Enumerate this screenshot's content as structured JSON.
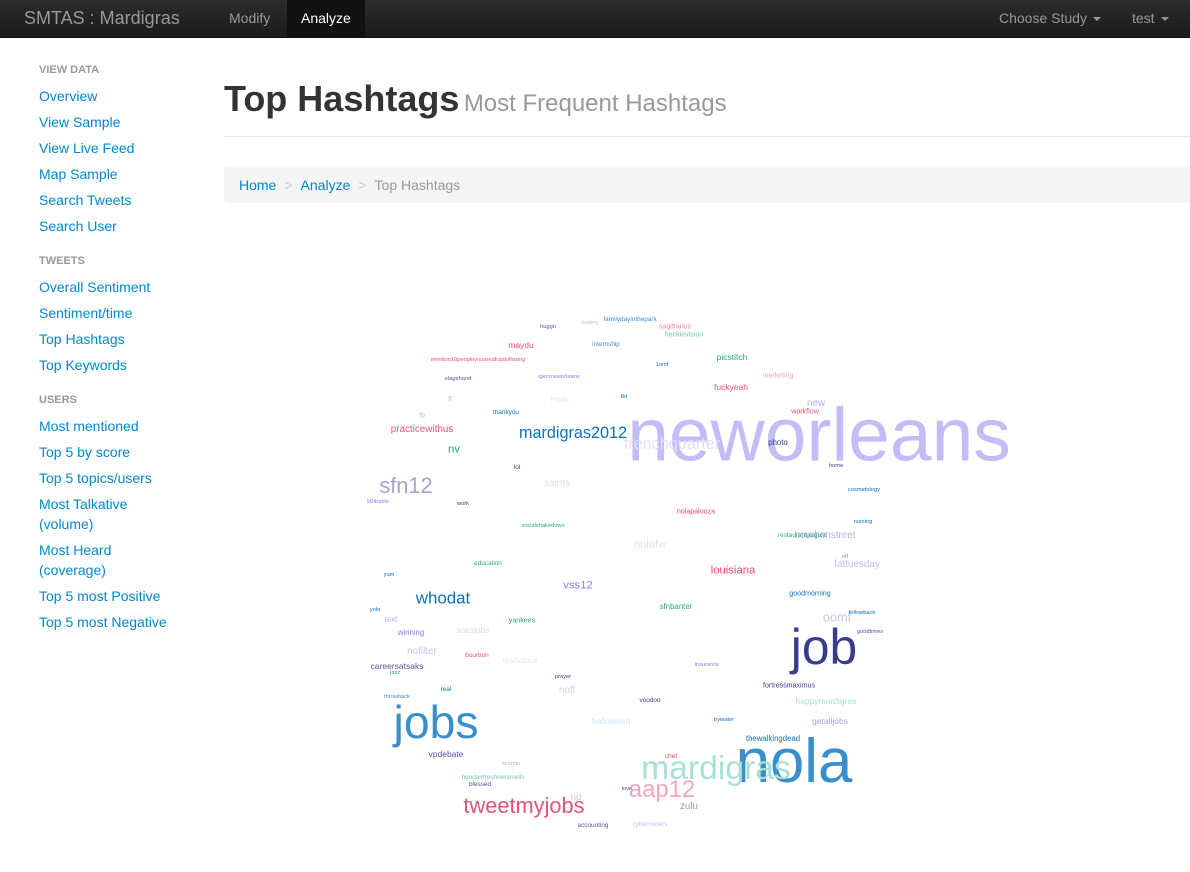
{
  "navbar": {
    "brand": "SMTAS : Mardigras",
    "items": [
      {
        "label": "Modify"
      },
      {
        "label": "Analyze",
        "active": true
      }
    ],
    "choose_study": "Choose Study",
    "user": "test"
  },
  "sidebar": {
    "sections": [
      {
        "header": "VIEW DATA",
        "items": [
          "Overview",
          "View Sample",
          "View Live Feed",
          "Map Sample",
          "Search Tweets",
          "Search User"
        ]
      },
      {
        "header": "TWEETS",
        "items": [
          "Overall Sentiment",
          "Sentiment/time",
          "Top Hashtags",
          "Top Keywords"
        ]
      },
      {
        "header": "USERS",
        "items": [
          "Most mentioned",
          "Top 5 by score",
          "Top 5 topics/users",
          "Most Talkative",
          "(volume)",
          "Most Heard",
          "(coverage)",
          "Top 5 most Positive",
          "Top 5 most Negative"
        ]
      }
    ]
  },
  "page": {
    "title": "Top Hashtags",
    "subtitle": "Most Frequent Hashtags"
  },
  "breadcrumb": {
    "home": "Home",
    "analyze": "Analyze",
    "current": "Top Hashtags",
    "separator": ">"
  },
  "wordcloud": {
    "words": [
      {
        "text": "neworleans",
        "weight": 100,
        "color": "#c2bcf7"
      },
      {
        "text": "nola",
        "weight": 81,
        "color": "#3a8ecb"
      },
      {
        "text": "job",
        "weight": 64,
        "color": "#393b8f"
      },
      {
        "text": "jobs",
        "weight": 59,
        "color": "#3a8ecb"
      },
      {
        "text": "mardigras",
        "weight": 41,
        "color": "#a8e0d5"
      },
      {
        "text": "aap12",
        "weight": 27,
        "color": "#f2a7bb"
      },
      {
        "text": "tweetmyjobs",
        "weight": 24,
        "color": "#e5527a"
      },
      {
        "text": "sfn12",
        "weight": 24,
        "color": "#a4a2cf"
      },
      {
        "text": "frenchquarter",
        "weight": 16,
        "color": "#e2def8"
      },
      {
        "text": "mardigras2012",
        "weight": 16,
        "color": "#1170b6"
      },
      {
        "text": "whodat",
        "weight": 17,
        "color": "#1170b6"
      },
      {
        "text": "louisiana",
        "weight": 9,
        "color": "#e84a6f"
      },
      {
        "text": "nolafw",
        "weight": 9,
        "color": "#fadbe3"
      },
      {
        "text": "practicewithus",
        "weight": 7,
        "color": "#e5527a"
      },
      {
        "text": "nv",
        "weight": 9,
        "color": "#2aa58a"
      },
      {
        "text": "vss12",
        "weight": 9,
        "color": "#8c7cf0"
      },
      {
        "text": "fattuesday",
        "weight": 7,
        "color": "#c2bcf7"
      },
      {
        "text": "bourbonstreet",
        "weight": 7,
        "color": "#b4b0dd"
      },
      {
        "text": "oomf",
        "weight": 11,
        "color": "#c9c4f5"
      },
      {
        "text": "new",
        "weight": 7,
        "color": "#b4b0f0"
      },
      {
        "text": "saints",
        "weight": 7,
        "color": "#dcdcf0"
      },
      {
        "text": "noff",
        "weight": 7,
        "color": "#d7d3f0"
      },
      {
        "text": "np",
        "weight": 7,
        "color": "#c9c4f5"
      },
      {
        "text": "nofilter",
        "weight": 7,
        "color": "#c9c4f5"
      },
      {
        "text": "zulu",
        "weight": 7,
        "color": "#9a98c9"
      },
      {
        "text": "happymardigras",
        "weight": 5,
        "color": "#a8e0d5"
      },
      {
        "text": "getalljobs",
        "weight": 5,
        "color": "#a79cf5"
      },
      {
        "text": "halloween",
        "weight": 5,
        "color": "#cfe0f2"
      },
      {
        "text": "vpdebate",
        "weight": 5,
        "color": "#5254a3"
      },
      {
        "text": "careersatsaks",
        "weight": 5,
        "color": "#5a56a0"
      },
      {
        "text": "saksjobs",
        "weight": 5,
        "color": "#cfe0f2"
      },
      {
        "text": "picstitch",
        "weight": 5,
        "color": "#2aa58a"
      },
      {
        "text": "fuckyeah",
        "weight": 5,
        "color": "#e5527a"
      },
      {
        "text": "thewalkingdead",
        "weight": 4,
        "color": "#1170b6"
      },
      {
        "text": "photo",
        "weight": 4,
        "color": "#393b8f"
      },
      {
        "text": "maydu",
        "weight": 5,
        "color": "#e5527a"
      },
      {
        "text": "sfnbanter",
        "weight": 4,
        "color": "#2aa58a"
      },
      {
        "text": "winning",
        "weight": 4,
        "color": "#8c7cf0"
      },
      {
        "text": "text",
        "weight": 4,
        "color": "#b4b0f0"
      },
      {
        "text": "yankees",
        "weight": 3,
        "color": "#2aa58a"
      },
      {
        "text": "reallydaux",
        "weight": 4,
        "color": "#dbe7f4"
      },
      {
        "text": "fortressmaximus",
        "weight": 3,
        "color": "#393b8f"
      },
      {
        "text": "marketing",
        "weight": 3,
        "color": "#f2a7bb"
      },
      {
        "text": "workflow",
        "weight": 3,
        "color": "#e5527a"
      },
      {
        "text": "music",
        "weight": 3,
        "color": "#dcdcf0"
      },
      {
        "text": "nolapalooza",
        "weight": 3,
        "color": "#e84a6f"
      },
      {
        "text": "goodmorning",
        "weight": 3,
        "color": "#1170b6"
      },
      {
        "text": "restaurantaugust",
        "weight": 2,
        "color": "#2aa58a"
      },
      {
        "text": "education",
        "weight": 2,
        "color": "#2aa58a"
      },
      {
        "text": "sagittarius",
        "weight": 3,
        "color": "#f08aa5"
      },
      {
        "text": "heckievision",
        "weight": 3,
        "color": "#6fc8b6"
      },
      {
        "text": "blessed",
        "weight": 2,
        "color": "#5254a3"
      },
      {
        "text": "hoodairfreshnersmells",
        "weight": 2,
        "color": "#6fc8b6"
      },
      {
        "text": "bourbon",
        "weight": 2,
        "color": "#e5527a"
      },
      {
        "text": "fb",
        "weight": 3,
        "color": "#c2bcf7"
      },
      {
        "text": "ff",
        "weight": 3,
        "color": "#c2bcf7"
      },
      {
        "text": "accounting",
        "weight": 2,
        "color": "#5254a3"
      },
      {
        "text": "cybercoders",
        "weight": 2,
        "color": "#c2bcf7"
      },
      {
        "text": "familydayinthepark",
        "weight": 2,
        "color": "#3a8ecb"
      },
      {
        "text": "internship",
        "weight": 2,
        "color": "#3a8ecb"
      },
      {
        "text": "mention10peopleyouareafraidoflosing",
        "weight": 1,
        "color": "#e5527a"
      },
      {
        "text": "igersneworleans",
        "weight": 1,
        "color": "#8c7cf0"
      },
      {
        "text": "thankyou",
        "weight": 2,
        "color": "#1170b6"
      },
      {
        "text": "lol",
        "weight": 2,
        "color": "#393b8f"
      },
      {
        "text": "chef",
        "weight": 2,
        "color": "#e84a6f"
      },
      {
        "text": "voodoo",
        "weight": 2,
        "color": "#393b8f"
      },
      {
        "text": "real",
        "weight": 2,
        "color": "#1170b6"
      },
      {
        "text": "prayer",
        "weight": 1,
        "color": "#393b8f"
      },
      {
        "text": "love",
        "weight": 1,
        "color": "#393b8f"
      },
      {
        "text": "yum",
        "weight": 1,
        "color": "#1170b6"
      },
      {
        "text": "yolo",
        "weight": 1,
        "color": "#1170b6"
      },
      {
        "text": "nfl",
        "weight": 1,
        "color": "#8c7cf0"
      },
      {
        "text": "work",
        "weight": 1,
        "color": "#393b8f"
      },
      {
        "text": "socialshakedown",
        "weight": 1,
        "color": "#2aa58a"
      },
      {
        "text": "scorpio",
        "weight": 1,
        "color": "#b4b0dd"
      },
      {
        "text": "boeing",
        "weight": 1,
        "color": "#c2bcf7"
      },
      {
        "text": "huggn",
        "weight": 1,
        "color": "#5254a3"
      },
      {
        "text": "stagehand",
        "weight": 1,
        "color": "#5254a3"
      },
      {
        "text": "tbt",
        "weight": 1,
        "color": "#1170b6"
      },
      {
        "text": "1omf",
        "weight": 1,
        "color": "#1170b6"
      },
      {
        "text": "504radio",
        "weight": 1,
        "color": "#8c7cf0"
      },
      {
        "text": "jazz",
        "weight": 1,
        "color": "#3a8ecb"
      },
      {
        "text": "throwback",
        "weight": 1,
        "color": "#3a8ecb"
      },
      {
        "text": "bywater",
        "weight": 1,
        "color": "#1170b6"
      },
      {
        "text": "insurance",
        "weight": 1,
        "color": "#8c7cf0"
      },
      {
        "text": "home",
        "weight": 1,
        "color": "#393b8f"
      },
      {
        "text": "nursing",
        "weight": 1,
        "color": "#1170b6"
      },
      {
        "text": "cosmetology",
        "weight": 1,
        "color": "#1170b6"
      },
      {
        "text": "followback",
        "weight": 1,
        "color": "#1170b6"
      },
      {
        "text": "goodtimes",
        "weight": 1,
        "color": "#5254a3"
      }
    ]
  }
}
